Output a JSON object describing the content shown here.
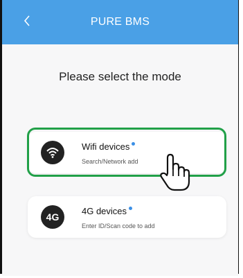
{
  "header": {
    "title": "PURE BMS",
    "back_icon": "chevron-left-icon"
  },
  "prompt": "Please select the mode",
  "modes": [
    {
      "icon": "wifi-icon",
      "title": "Wifi devices",
      "subtitle": "Search/Network add"
    },
    {
      "icon": "4g-icon",
      "icon_text": "4G",
      "title": "4G devices",
      "subtitle": "Enter ID/Scan code to add"
    }
  ],
  "colors": {
    "header": "#4aa0e6",
    "highlight": "#21a048",
    "dot": "#3a8fe6"
  }
}
